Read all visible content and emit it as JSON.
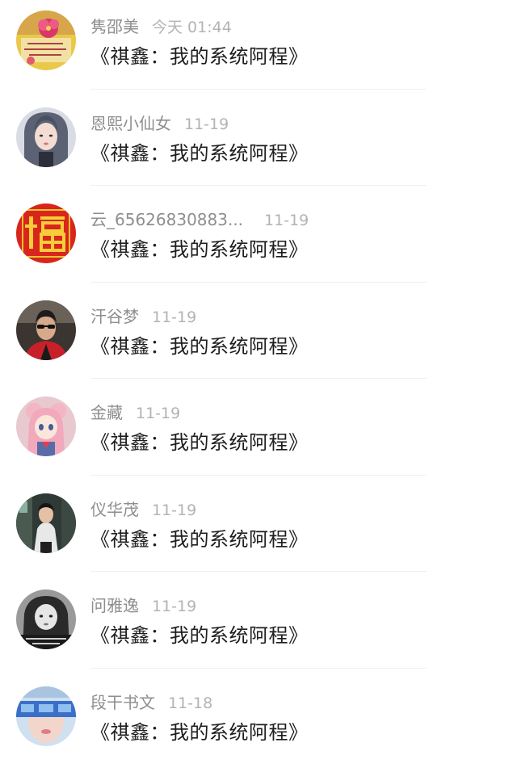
{
  "comments": [
    {
      "username": "隽邵美",
      "time": "今天 01:44",
      "text": "《祺鑫：我的系统阿程》",
      "avatar": "flower-card-avatar"
    },
    {
      "username": "恩熙小仙女",
      "time": "11-19",
      "text": "《祺鑫：我的系统阿程》",
      "avatar": "girl-portrait-avatar"
    },
    {
      "username": "云_65626830883...",
      "time": "11-19",
      "text": "《祺鑫：我的系统阿程》",
      "avatar": "fu-character-avatar"
    },
    {
      "username": "汗谷梦",
      "time": "11-19",
      "text": "《祺鑫：我的系统阿程》",
      "avatar": "man-sunglasses-avatar"
    },
    {
      "username": "金藏",
      "time": "11-19",
      "text": "《祺鑫：我的系统阿程》",
      "avatar": "anime-girl-avatar"
    },
    {
      "username": "仪华茂",
      "time": "11-19",
      "text": "《祺鑫：我的系统阿程》",
      "avatar": "boy-street-avatar"
    },
    {
      "username": "问雅逸",
      "time": "11-19",
      "text": "《祺鑫：我的系统阿程》",
      "avatar": "bw-girl-avatar"
    },
    {
      "username": "段干书文",
      "time": "11-18",
      "text": "《祺鑫：我的系统阿程》",
      "avatar": "blue-face-avatar"
    }
  ]
}
